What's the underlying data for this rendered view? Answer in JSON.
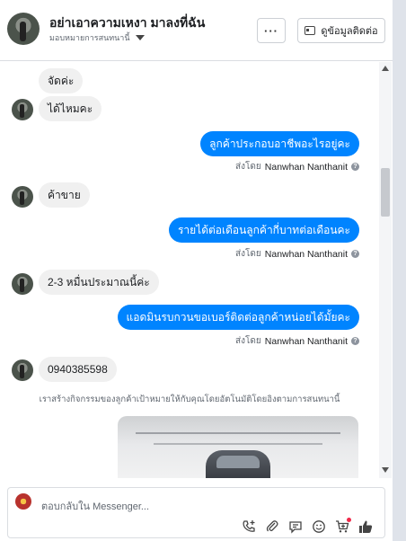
{
  "header": {
    "title": "อย่าเอาความเหงา มาลงที่ฉัน",
    "assign_label": "มอบหมายการสนทนานี้",
    "more_label": "···",
    "contact_label": "ดูข้อมูลติดต่อ"
  },
  "messages": {
    "m1": "จัดค่ะ",
    "m2": "ได้ไหมคะ",
    "m3": "ลูกค้าประกอบอาชีพอะไรอยู่คะ",
    "m4": "ค้าขาย",
    "m5": "รายได้ต่อเดือนลูกค้ากี่บาทต่อเดือนคะ",
    "m6": "2-3 หมื่นประมาณนี้ค่ะ",
    "m7": "แอดมินรบกวนขอเบอร์ติดต่อลูกค้าหน่อยได้มั้ยคะ",
    "m8": "0940385598"
  },
  "sent_by": {
    "prefix": "ส่งโดย",
    "name": "Nanwhan Nanthanit",
    "help": "?"
  },
  "notice": "เราสร้างกิจกรรมของลูกค้าเป้าหมายให้กับคุณโดยอัตโนมัติโดยอิงตามการสนทนานี้",
  "composer": {
    "placeholder": "ตอบกลับใน Messenger..."
  },
  "colors": {
    "outgoing": "#0084ff",
    "incoming": "#f0f0f0"
  }
}
